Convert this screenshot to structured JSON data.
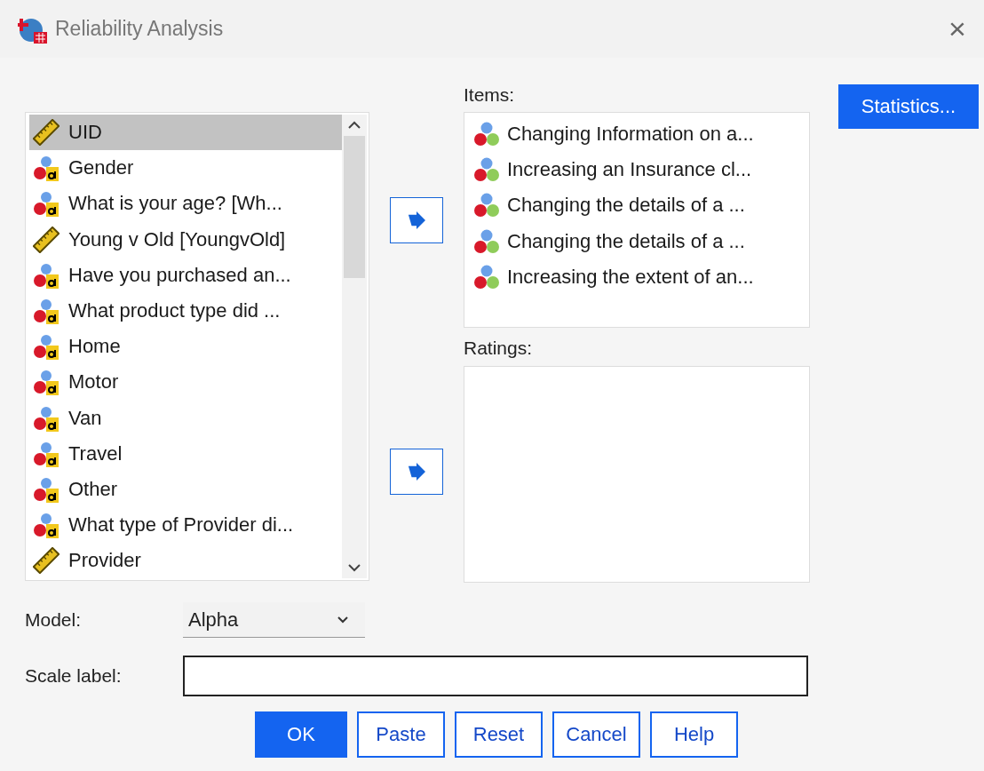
{
  "window": {
    "title": "Reliability Analysis",
    "close": "×"
  },
  "variables": [
    {
      "label": "UID",
      "kind": "scale",
      "selected": true
    },
    {
      "label": "Gender",
      "kind": "string",
      "selected": false
    },
    {
      "label": "What is your age? [Wh...",
      "kind": "string",
      "selected": false
    },
    {
      "label": "Young v Old [YoungvOld]",
      "kind": "scale",
      "selected": false
    },
    {
      "label": "Have you purchased an...",
      "kind": "string",
      "selected": false
    },
    {
      "label": "What product type did ...",
      "kind": "string",
      "selected": false
    },
    {
      "label": "Home",
      "kind": "string",
      "selected": false
    },
    {
      "label": "Motor",
      "kind": "string",
      "selected": false
    },
    {
      "label": "Van",
      "kind": "string",
      "selected": false
    },
    {
      "label": "Travel",
      "kind": "string",
      "selected": false
    },
    {
      "label": "Other",
      "kind": "string",
      "selected": false
    },
    {
      "label": "What type of Provider di...",
      "kind": "string",
      "selected": false
    },
    {
      "label": "Provider",
      "kind": "scale",
      "selected": false
    }
  ],
  "items": {
    "label": "Items:",
    "entries": [
      {
        "label": "Changing Information on a...",
        "kind": "nominal",
        "selected": false
      },
      {
        "label": "Increasing an Insurance cl...",
        "kind": "nominal",
        "selected": false
      },
      {
        "label": "Changing the details of a ...",
        "kind": "nominal",
        "selected": false
      },
      {
        "label": "Changing the details of a ...",
        "kind": "nominal",
        "selected": false
      },
      {
        "label": "Increasing the extent of an...",
        "kind": "nominal",
        "selected": false
      }
    ]
  },
  "ratings": {
    "label": "Ratings:"
  },
  "statistics_button": "Statistics...",
  "model": {
    "label": "Model:",
    "value": "Alpha"
  },
  "scale_label": {
    "label": "Scale label:"
  },
  "buttons": [
    {
      "label": "OK",
      "primary": true
    },
    {
      "label": "Paste",
      "primary": false
    },
    {
      "label": "Reset",
      "primary": false
    },
    {
      "label": "Cancel",
      "primary": false
    },
    {
      "label": "Help",
      "primary": false
    }
  ]
}
